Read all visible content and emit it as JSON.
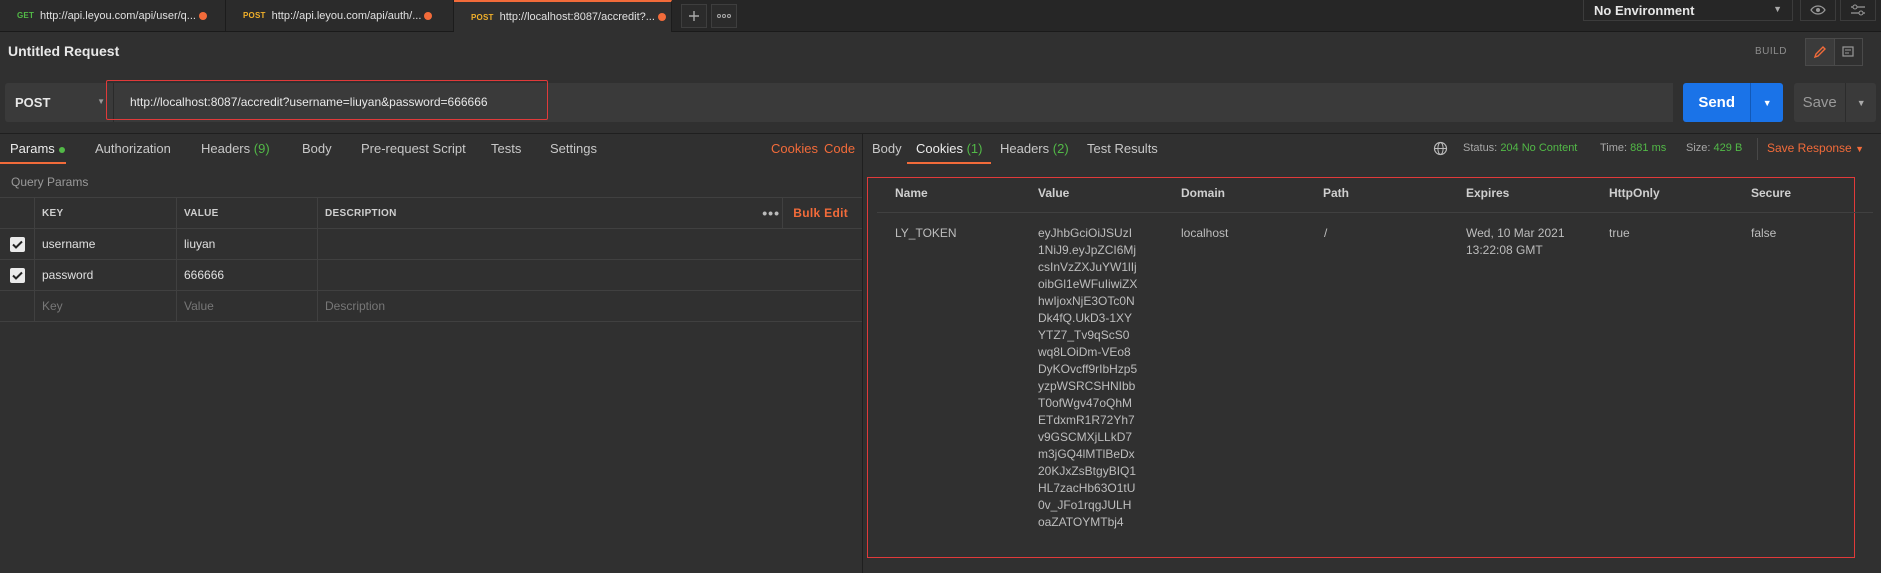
{
  "tabs": [
    {
      "method": "GET",
      "url": "http://api.leyou.com/api/user/q...",
      "method_color": "#52b947",
      "unsaved": true,
      "active": false
    },
    {
      "method": "POST",
      "url": "http://api.leyou.com/api/auth/...",
      "method_color": "#f2b12a",
      "unsaved": true,
      "active": false
    },
    {
      "method": "POST",
      "url": "http://localhost:8087/accredit?...",
      "method_color": "#f2b12a",
      "unsaved": true,
      "active": true
    }
  ],
  "tab_actions": {
    "new_tab_icon": "plus-icon",
    "more_icon": "ellipsis-icon"
  },
  "environment": {
    "selected": "No Environment"
  },
  "request": {
    "title": "Untitled Request",
    "build_label": "BUILD",
    "method": "POST",
    "url": "http://localhost:8087/accredit?username=liuyan&password=666666",
    "send_label": "Send",
    "save_label": "Save"
  },
  "request_tabs": {
    "params": "Params",
    "authorization": "Authorization",
    "headers": "Headers",
    "headers_count": "(9)",
    "body": "Body",
    "pre_request": "Pre-request Script",
    "tests": "Tests",
    "settings": "Settings",
    "cookies_link": "Cookies",
    "code_link": "Code"
  },
  "query_params": {
    "section_label": "Query Params",
    "headers": {
      "key": "KEY",
      "value": "VALUE",
      "description": "DESCRIPTION"
    },
    "bulk_edit": "Bulk Edit",
    "rows": [
      {
        "key": "username",
        "value": "liuyan",
        "description": "",
        "checked": true
      },
      {
        "key": "password",
        "value": "666666",
        "description": "",
        "checked": true
      }
    ],
    "placeholders": {
      "key": "Key",
      "value": "Value",
      "description": "Description"
    }
  },
  "response": {
    "tabs": {
      "body": "Body",
      "cookies": "Cookies",
      "cookies_count": "(1)",
      "headers": "Headers",
      "headers_count": "(2)",
      "test_results": "Test Results"
    },
    "status_label": "Status:",
    "status_value": "204 No Content",
    "time_label": "Time:",
    "time_value": "881 ms",
    "size_label": "Size:",
    "size_value": "429 B",
    "save_response": "Save Response",
    "cookie_columns": {
      "name": "Name",
      "value": "Value",
      "domain": "Domain",
      "path": "Path",
      "expires": "Expires",
      "httponly": "HttpOnly",
      "secure": "Secure"
    },
    "cookies": [
      {
        "name": "LY_TOKEN",
        "value": "eyJhbGciOiJSUzI1NiJ9.eyJpZCI6MjcsInVzZXJuYW1lIjoibGl1eWFuIiwiZXhwIjoxNjE3OTc0NDk4fQ.UkD3-1XYYTZ7_Tv9qScS0wq8LOiDm-VEo8DyKOvcff9rIbHzp5yzpWSRCSHNIbbT0ofWgv47oQhMETdxmR1R72Yh7v9GSCMXjLLkD7m3jGQ4lMTlBeDx20KJxZsBtgyBIQ1HL7zacHb63O1tU0v_JFo1rqgJULHoaZATOYMTbj4",
        "domain": "localhost",
        "path": "/",
        "expires": "Wed, 10 Mar 2021 13:22:08 GMT",
        "httponly": "true",
        "secure": "false"
      }
    ]
  },
  "colors": {
    "accent": "#f26b3a",
    "send": "#1a73e8",
    "success": "#52b947",
    "highlight": "#e03a3a"
  }
}
